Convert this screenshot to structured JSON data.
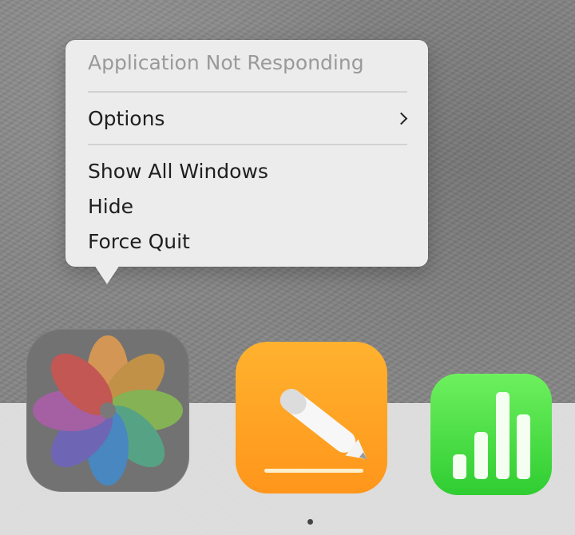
{
  "menu": {
    "title": "Application Not Responding",
    "items": [
      {
        "label": "Options",
        "has_submenu": true
      },
      {
        "label": "Show All Windows"
      },
      {
        "label": "Hide"
      },
      {
        "label": "Force Quit"
      }
    ]
  },
  "dock": {
    "apps": [
      {
        "name": "Photos",
        "icon": "photos-icon",
        "state": "dimmed"
      },
      {
        "name": "Pages",
        "icon": "pages-icon"
      },
      {
        "name": "Numbers",
        "icon": "numbers-icon"
      }
    ]
  },
  "colors": {
    "menu_bg": "#ececec",
    "menu_disabled_text": "#9a9a9a",
    "menu_text": "#1f1f1f",
    "pages_orange": "#ff9f1d",
    "numbers_green": "#37d43a"
  }
}
